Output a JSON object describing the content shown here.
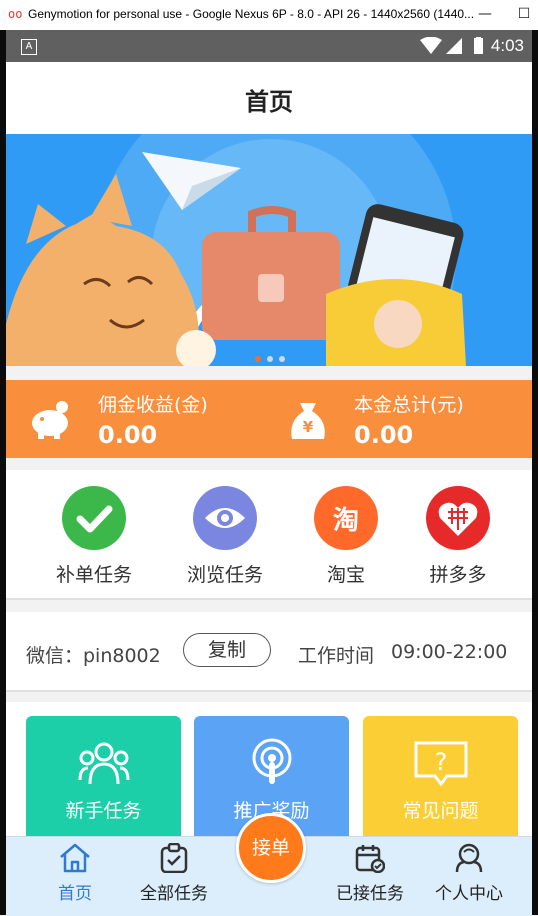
{
  "window": {
    "title": "Genymotion for personal use - Google Nexus 6P - 8.0 - API 26 - 1440x2560 (1440...",
    "logo": "oo",
    "buttons": [
      "—",
      "☐"
    ]
  },
  "statusbar": {
    "notif_icon": "A",
    "time": "4:03"
  },
  "header": {
    "title": "首页"
  },
  "banner": {
    "dots": 3,
    "active_dot": 0
  },
  "earnings": [
    {
      "label": "佣金收益(金)",
      "value": "0.00",
      "icon": "piggy-bank-icon"
    },
    {
      "label": "本金总计(元)",
      "value": "0.00",
      "icon": "money-bag-icon",
      "icon_glyph": "¥"
    }
  ],
  "categories": [
    {
      "label": "补单任务",
      "icon": "check-icon",
      "color": "#3cb84b"
    },
    {
      "label": "浏览任务",
      "icon": "eye-icon",
      "color": "#7a86e0"
    },
    {
      "label": "淘宝",
      "icon": "taobao-icon",
      "color": "#ff6a2b",
      "glyph": "淘"
    },
    {
      "label": "拼多多",
      "icon": "pinduoduo-icon",
      "color": "#e62a2a"
    }
  ],
  "contact": {
    "wechat_label": "微信：pin8002",
    "copy_label": "复制",
    "hours_label": "工作时间",
    "hours_value": "09:00-22:00"
  },
  "tiles": [
    {
      "label": "新手任务",
      "icon": "people-icon",
      "color": "#1ccfa8"
    },
    {
      "label": "推广奖励",
      "icon": "broadcast-icon",
      "color": "#5aa3f5"
    },
    {
      "label": "常见问题",
      "icon": "question-icon",
      "color": "#fbce35",
      "glyph": "?"
    }
  ],
  "tabbar": {
    "items": [
      {
        "label": "首页",
        "icon": "home-icon"
      },
      {
        "label": "全部任务",
        "icon": "clipboard-icon"
      },
      {
        "label": "已接任务",
        "icon": "calendar-check-icon"
      },
      {
        "label": "个人中心",
        "icon": "user-icon"
      }
    ],
    "fab_label": "接单",
    "active_color": "#2e7bd0"
  }
}
